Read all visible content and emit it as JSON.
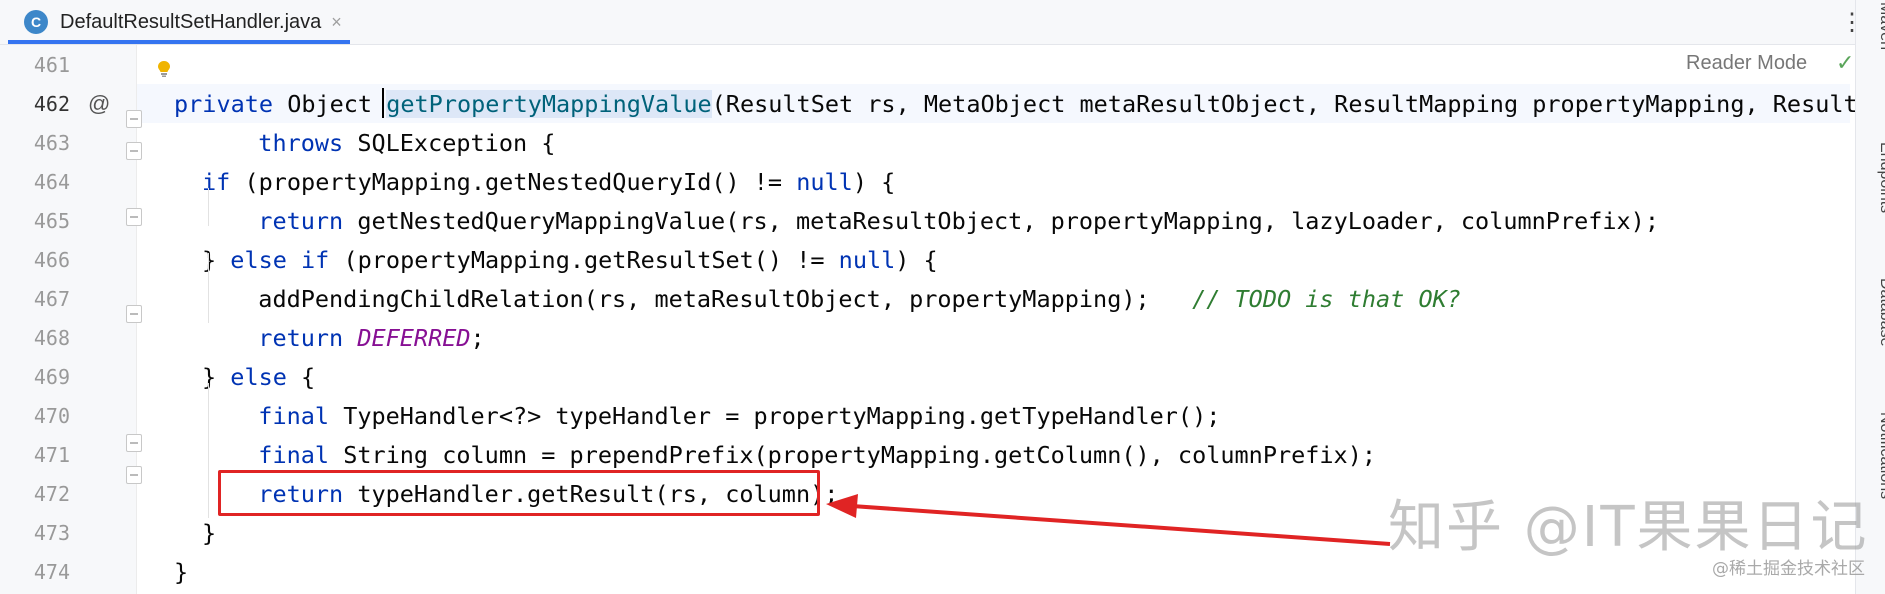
{
  "tab": {
    "icon_letter": "C",
    "title": "DefaultResultSetHandler.java",
    "close": "×"
  },
  "menu_glyph": "⋮",
  "reader_mode": "Reader Mode",
  "inspection_glyph": "✓",
  "gutter_marker": "@",
  "right_panel": [
    "Maven",
    "Endpoints",
    "Database",
    "Notifications"
  ],
  "lines": [
    {
      "num": "461",
      "segments": []
    },
    {
      "num": "462",
      "segments": [
        {
          "t": "private ",
          "c": "kw"
        },
        {
          "t": "Object ",
          "c": ""
        },
        {
          "t": "getPropertyMappingValue",
          "c": "fn hl"
        },
        {
          "t": "(ResultSet rs, MetaObject metaResultObject, ResultMapping propertyMapping, ResultLo",
          "c": ""
        }
      ]
    },
    {
      "num": "463",
      "segments": [
        {
          "t": "  throws ",
          "c": "kw"
        },
        {
          "t": "SQLException {",
          "c": ""
        }
      ]
    },
    {
      "num": "464",
      "segments": [
        {
          "t": "if ",
          "c": "kw"
        },
        {
          "t": "(propertyMapping.getNestedQueryId() != ",
          "c": ""
        },
        {
          "t": "null",
          "c": "kw"
        },
        {
          "t": ") {",
          "c": ""
        }
      ]
    },
    {
      "num": "465",
      "segments": [
        {
          "t": "  return ",
          "c": "kw"
        },
        {
          "t": "getNestedQueryMappingValue(rs, metaResultObject, propertyMapping, lazyLoader, columnPrefix);",
          "c": ""
        }
      ]
    },
    {
      "num": "466",
      "segments": [
        {
          "t": "} ",
          "c": ""
        },
        {
          "t": "else if ",
          "c": "kw"
        },
        {
          "t": "(propertyMapping.getResultSet() != ",
          "c": ""
        },
        {
          "t": "null",
          "c": "kw"
        },
        {
          "t": ") {",
          "c": ""
        }
      ]
    },
    {
      "num": "467",
      "segments": [
        {
          "t": "  addPendingChildRelation(rs, metaResultObject, propertyMapping);   ",
          "c": ""
        },
        {
          "t": "// TODO is that OK?",
          "c": "cmt"
        }
      ]
    },
    {
      "num": "468",
      "segments": [
        {
          "t": "  return ",
          "c": "kw"
        },
        {
          "t": "DEFERRED",
          "c": "cst"
        },
        {
          "t": ";",
          "c": ""
        }
      ]
    },
    {
      "num": "469",
      "segments": [
        {
          "t": "} ",
          "c": ""
        },
        {
          "t": "else ",
          "c": "kw"
        },
        {
          "t": "{",
          "c": ""
        }
      ]
    },
    {
      "num": "470",
      "segments": [
        {
          "t": "  final ",
          "c": "kw"
        },
        {
          "t": "TypeHandler<?> typeHandler = propertyMapping.getTypeHandler();",
          "c": ""
        }
      ]
    },
    {
      "num": "471",
      "segments": [
        {
          "t": "  final ",
          "c": "kw"
        },
        {
          "t": "String column = prependPrefix(propertyMapping.getColumn(), columnPrefix);",
          "c": ""
        }
      ]
    },
    {
      "num": "472",
      "segments": [
        {
          "t": "  return ",
          "c": "kw"
        },
        {
          "t": "typeHandler.getResult(rs, column);",
          "c": ""
        }
      ]
    },
    {
      "num": "473",
      "segments": [
        {
          "t": "}",
          "c": ""
        }
      ]
    },
    {
      "num": "474",
      "segments": [
        {
          "t": "}",
          "c": ""
        }
      ]
    }
  ],
  "watermark": "知乎 @IT果果日记",
  "watermark_small": "@稀土掘金技术社区",
  "colors": {
    "keyword": "#0033b3",
    "method": "#00627a",
    "constant": "#871094",
    "comment": "#2f7d32",
    "annotation": "#e02424",
    "accent": "#3574f0"
  }
}
